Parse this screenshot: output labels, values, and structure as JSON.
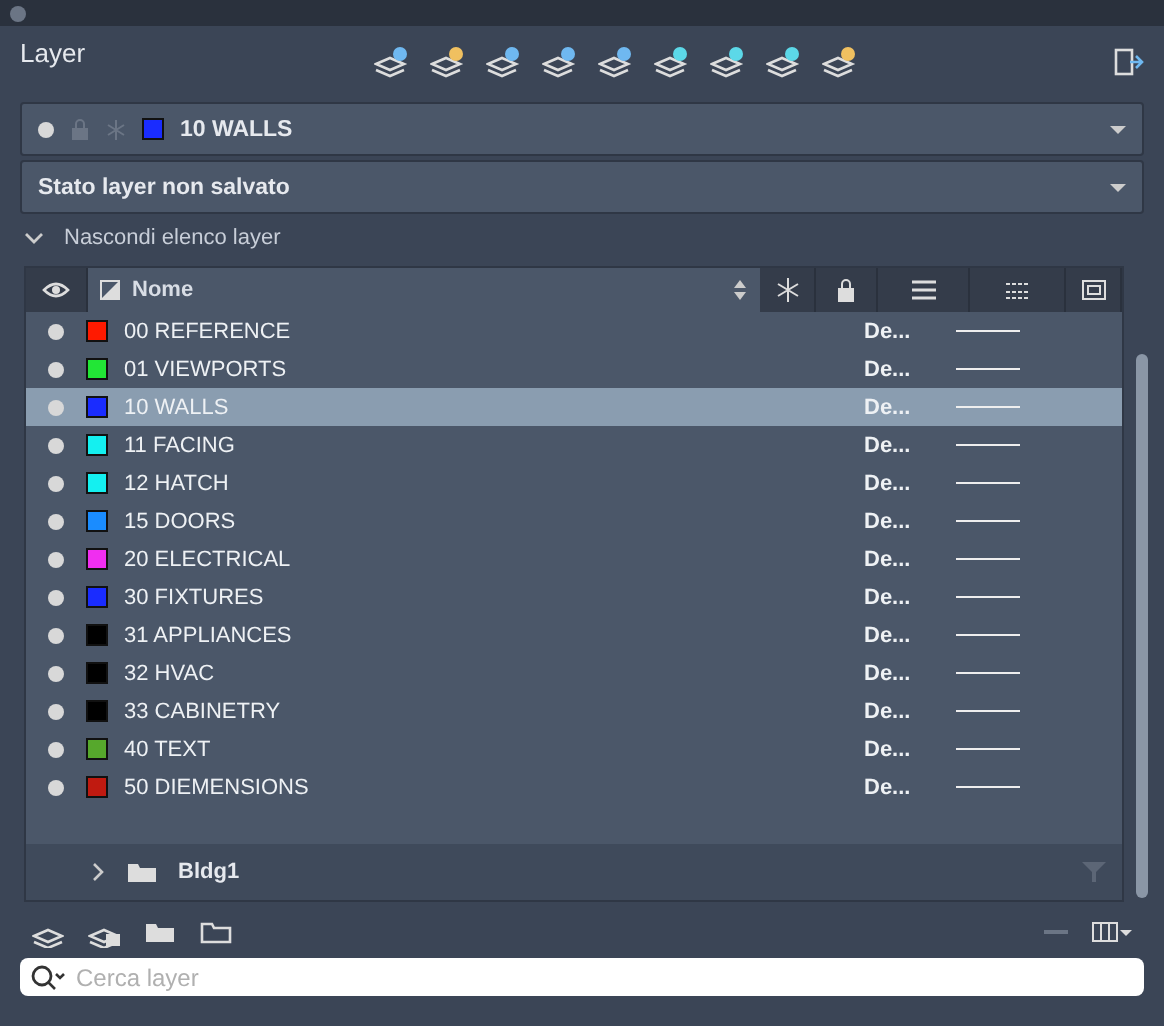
{
  "panel": {
    "title": "Layer"
  },
  "current_layer": {
    "name": "10 WALLS",
    "color": "#1a2cff"
  },
  "layer_state": {
    "value": "Stato layer non salvato"
  },
  "collapse": {
    "label": "Nascondi elenco layer",
    "expanded": true
  },
  "table": {
    "columns": [
      {
        "label": "Nome"
      }
    ],
    "rows": [
      {
        "name": "00 REFERENCE",
        "color": "#ff1a00",
        "linetype": "De...",
        "selected": false
      },
      {
        "name": "01 VIEWPORTS",
        "color": "#22e636",
        "linetype": "De...",
        "selected": false
      },
      {
        "name": "10 WALLS",
        "color": "#1a2cff",
        "linetype": "De...",
        "selected": true
      },
      {
        "name": "11 FACING",
        "color": "#14f0f0",
        "linetype": "De...",
        "selected": false
      },
      {
        "name": "12 HATCH",
        "color": "#14f0f0",
        "linetype": "De...",
        "selected": false
      },
      {
        "name": "15 DOORS",
        "color": "#1a8cff",
        "linetype": "De...",
        "selected": false
      },
      {
        "name": "20 ELECTRICAL",
        "color": "#f02ef0",
        "linetype": "De...",
        "selected": false
      },
      {
        "name": "30 FIXTURES",
        "color": "#1a2cff",
        "linetype": "De...",
        "selected": false
      },
      {
        "name": "31 APPLIANCES",
        "color": "#000000",
        "linetype": "De...",
        "selected": false
      },
      {
        "name": "32 HVAC",
        "color": "#000000",
        "linetype": "De...",
        "selected": false
      },
      {
        "name": "33 CABINETRY",
        "color": "#000000",
        "linetype": "De...",
        "selected": false
      },
      {
        "name": "40 TEXT",
        "color": "#56a82c",
        "linetype": "De...",
        "selected": false
      },
      {
        "name": "50 DIEMENSIONS",
        "color": "#c01a10",
        "linetype": "De...",
        "selected": false
      }
    ]
  },
  "groups": [
    {
      "name": "Bldg1",
      "expanded": false
    }
  ],
  "search": {
    "placeholder": "Cerca layer"
  }
}
